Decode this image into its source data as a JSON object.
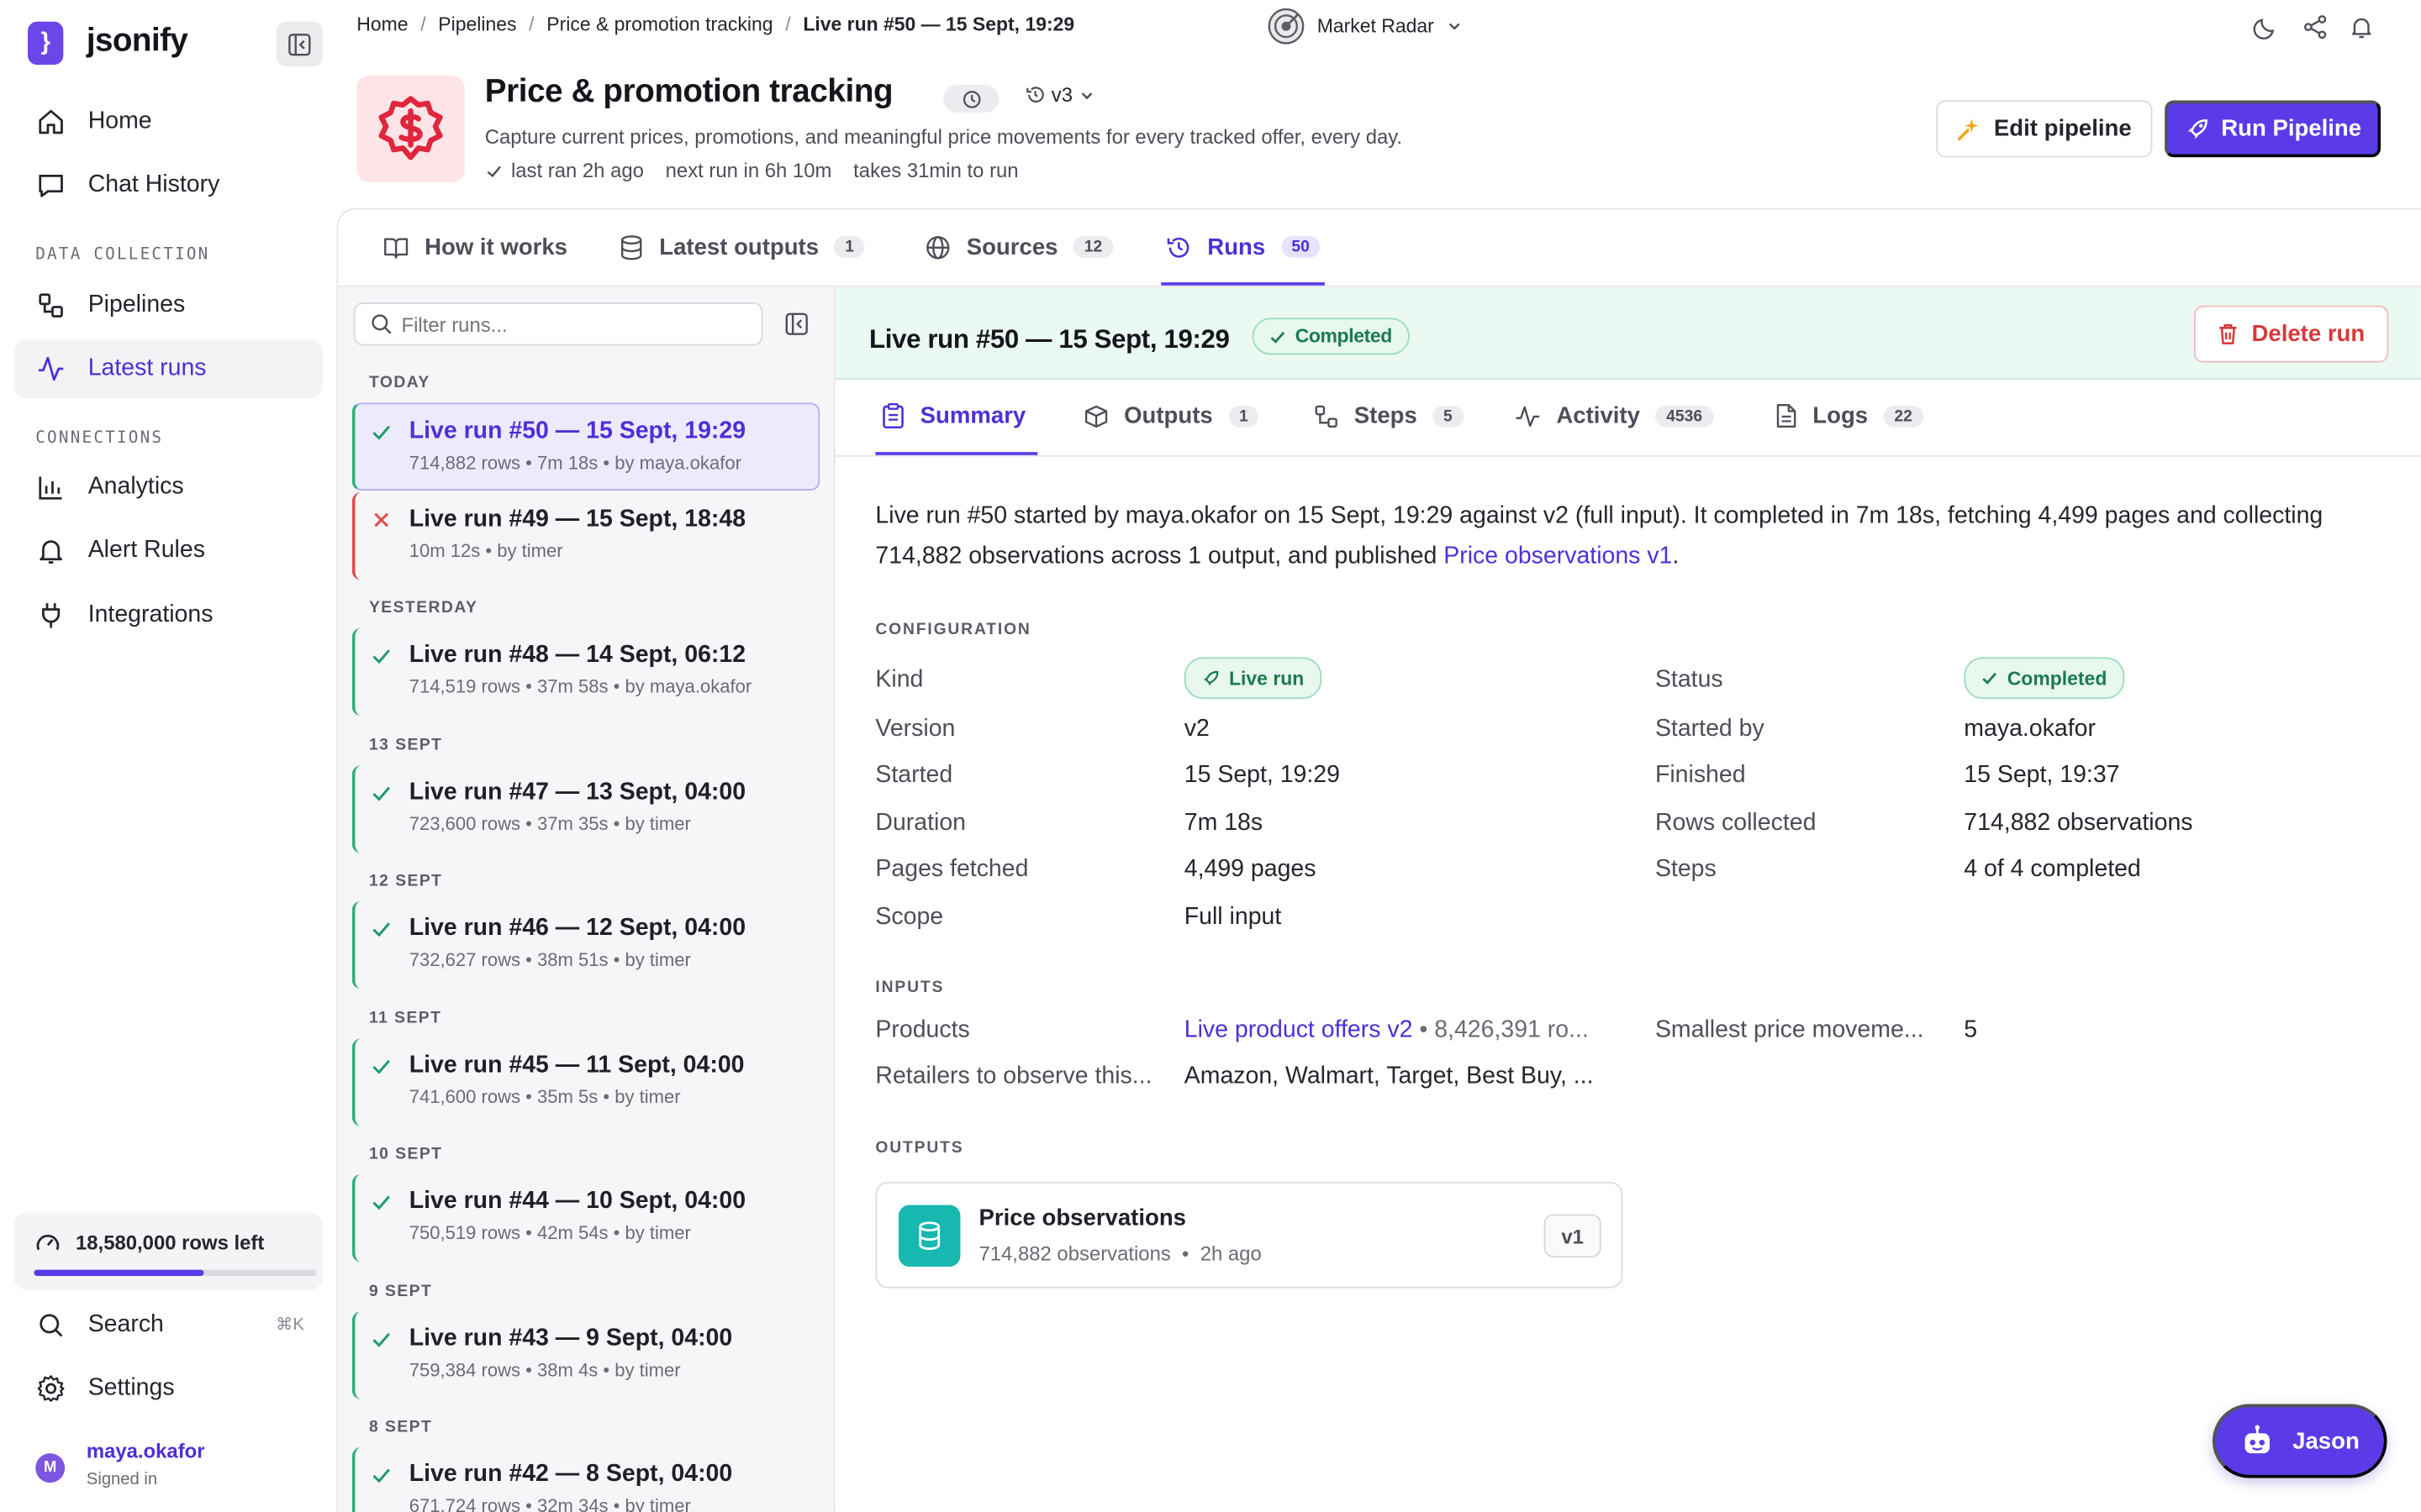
{
  "app": {
    "name": "jsonify",
    "logo_glyph": "}"
  },
  "sidebar": {
    "items_top": [
      {
        "label": "Home",
        "icon": "home-icon"
      },
      {
        "label": "Chat History",
        "icon": "chat-icon"
      }
    ],
    "section_data": "DATA COLLECTION",
    "items_data": [
      {
        "label": "Pipelines",
        "icon": "pipelines-icon"
      },
      {
        "label": "Latest runs",
        "icon": "activity-icon",
        "active": true
      }
    ],
    "section_connections": "CONNECTIONS",
    "items_connections": [
      {
        "label": "Analytics",
        "icon": "chart-icon"
      },
      {
        "label": "Alert Rules",
        "icon": "bell-icon"
      },
      {
        "label": "Integrations",
        "icon": "plug-icon"
      }
    ],
    "quota": {
      "label": "18,580,000 rows left",
      "fraction_used": 0.6
    },
    "search": {
      "label": "Search",
      "shortcut": "⌘K"
    },
    "settings_label": "Settings",
    "user": {
      "initial": "M",
      "name": "maya.okafor",
      "status": "Signed in"
    }
  },
  "breadcrumb": [
    "Home",
    "Pipelines",
    "Price & promotion tracking",
    "Live run #50 — 15 Sept, 19:29"
  ],
  "workspace": {
    "name": "Market Radar"
  },
  "pipeline": {
    "title": "Price & promotion tracking",
    "version": "v3",
    "description": "Capture current prices, promotions, and meaningful price movements for every tracked offer, every day.",
    "last_ran": "last ran 2h ago",
    "next_run": "next run in 6h 10m",
    "duration": "takes 31min to run",
    "edit_label": "Edit pipeline",
    "run_label": "Run Pipeline"
  },
  "tabs": [
    {
      "label": "How it works",
      "icon": "book-icon",
      "badge": ""
    },
    {
      "label": "Latest outputs",
      "icon": "database-icon",
      "badge": "1"
    },
    {
      "label": "Sources",
      "icon": "globe-icon",
      "badge": "12"
    },
    {
      "label": "Runs",
      "icon": "history-icon",
      "badge": "50",
      "active": true
    }
  ],
  "runs_list": {
    "filter_placeholder": "Filter runs...",
    "groups": [
      {
        "label": "TODAY"
      },
      {
        "label": "YESTERDAY"
      },
      {
        "label": "13 SEPT"
      },
      {
        "label": "12 SEPT"
      },
      {
        "label": "11 SEPT"
      },
      {
        "label": "10 SEPT"
      },
      {
        "label": "9 SEPT"
      },
      {
        "label": "8 SEPT"
      }
    ],
    "runs": [
      {
        "title": "Live run #50 — 15 Sept, 19:29",
        "sub": "714,882 rows • 7m 18s • by maya.okafor",
        "status": "ok"
      },
      {
        "title": "Live run #49 — 15 Sept, 18:48",
        "sub": "10m 12s • by timer",
        "status": "failed"
      },
      {
        "title": "Live run #48 — 14 Sept, 06:12",
        "sub": "714,519 rows • 37m 58s • by maya.okafor",
        "status": "ok"
      },
      {
        "title": "Live run #47 — 13 Sept, 04:00",
        "sub": "723,600 rows • 37m 35s • by timer",
        "status": "ok"
      },
      {
        "title": "Live run #46 — 12 Sept, 04:00",
        "sub": "732,627 rows • 38m 51s • by timer",
        "status": "ok"
      },
      {
        "title": "Live run #45 — 11 Sept, 04:00",
        "sub": "741,600 rows • 35m 5s • by timer",
        "status": "ok"
      },
      {
        "title": "Live run #44 — 10 Sept, 04:00",
        "sub": "750,519 rows • 42m 54s • by timer",
        "status": "ok"
      },
      {
        "title": "Live run #43 — 9 Sept, 04:00",
        "sub": "759,384 rows • 38m 4s • by timer",
        "status": "ok"
      },
      {
        "title": "Live run #42 — 8 Sept, 04:00",
        "sub": "671,724 rows • 32m 34s • by timer",
        "status": "ok"
      }
    ]
  },
  "run_detail": {
    "title": "Live run #50 — 15 Sept, 19:29",
    "status": "Completed",
    "delete_label": "Delete run",
    "tabs": [
      {
        "label": "Summary",
        "icon": "clipboard-icon",
        "badge": ""
      },
      {
        "label": "Outputs",
        "icon": "package-icon",
        "badge": "1"
      },
      {
        "label": "Steps",
        "icon": "steps-icon",
        "badge": "5"
      },
      {
        "label": "Activity",
        "icon": "activity-icon",
        "badge": "4536"
      },
      {
        "label": "Logs",
        "icon": "file-icon",
        "badge": "22"
      }
    ],
    "summary_text": "Live run #50 started by maya.okafor on 15 Sept, 19:29 against v2 (full input). It completed in 7m 18s, fetching 4,499 pages and collecting 714,882 observations across 1 output, and published ",
    "summary_link": "Price observations v1",
    "summary_end": ".",
    "configuration_label": "CONFIGURATION",
    "config_left": [
      {
        "label": "Kind",
        "value": "Live run"
      },
      {
        "label": "Version",
        "value": "v2"
      },
      {
        "label": "Started",
        "value": "15 Sept, 19:29"
      },
      {
        "label": "Duration",
        "value": "7m 18s"
      },
      {
        "label": "Pages fetched",
        "value": "4,499 pages"
      },
      {
        "label": "Scope",
        "value": "Full input"
      }
    ],
    "config_right": [
      {
        "label": "Status",
        "value": "Completed"
      },
      {
        "label": "Started by",
        "value": "maya.okafor"
      },
      {
        "label": "Finished",
        "value": "15 Sept, 19:37"
      },
      {
        "label": "Rows collected",
        "value": "714,882 observations"
      },
      {
        "label": "Steps",
        "value": "4 of 4 completed"
      }
    ],
    "inputs_label": "INPUTS",
    "inputs": [
      {
        "label": "Products",
        "value_link": "Live product offers v2",
        "value_extra": " • 8,426,391 ro..."
      },
      {
        "label": "Retailers to observe this...",
        "value": "Amazon, Walmart, Target, Best Buy, ..."
      },
      {
        "label": "Smallest price moveme...",
        "value": "5"
      }
    ],
    "outputs_label": "OUTPUTS",
    "output": {
      "name": "Price observations",
      "count": "714,882 observations",
      "age": "2h ago",
      "version": "v1"
    }
  },
  "assistant": {
    "label": "Jason"
  },
  "colors": {
    "accent": "#5b3be8",
    "success": "#1b7b4e",
    "danger": "#d63a3a",
    "teal": "#16b8b0"
  }
}
